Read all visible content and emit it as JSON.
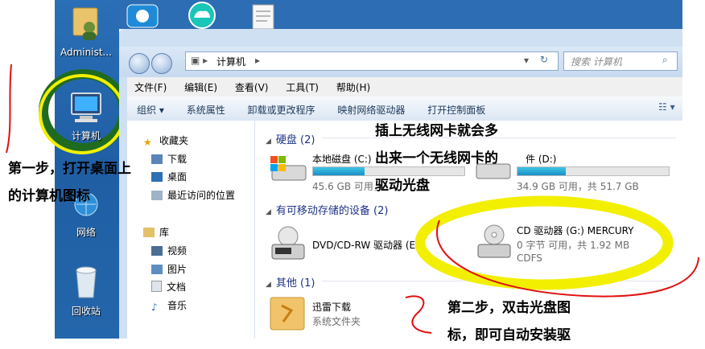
{
  "desktop": {
    "admin_label": "Administ...",
    "computer_label": "计算机",
    "network_label": "网络",
    "recycle_label": "回收站"
  },
  "window": {
    "address": "计算机",
    "search_placeholder": "搜索 计算机",
    "menu": [
      "文件(F)",
      "编辑(E)",
      "查看(V)",
      "工具(T)",
      "帮助(H)"
    ],
    "toolbar": {
      "organize": "组织",
      "items": [
        "系统属性",
        "卸载或更改程序",
        "映射网络驱动器",
        "打开控制面板"
      ]
    },
    "nav": {
      "favorites": "收藏夹",
      "downloads": "下载",
      "desktop": "桌面",
      "recent": "最近访问的位置",
      "libraries": "库",
      "videos": "视频",
      "pictures": "图片",
      "documents": "文档",
      "music": "音乐"
    },
    "groups": {
      "hdd": "硬盘 (2)",
      "removable": "有可移动存储的设备 (2)",
      "other": "其他 (1)"
    },
    "drives": {
      "c_name": "本地磁盘 (C:)",
      "c_free": "45.6 GB 可用，",
      "c_fill": 0.34,
      "d_name": "件 (D:)",
      "d_free": "34.9 GB 可用，共 51.7 GB",
      "d_fill": 0.32,
      "dvd_name": "DVD/CD-RW 驱动器 (E:)",
      "cd_name": "CD 驱动器 (G:) MERCURY",
      "cd_size": "0 字节 可用，共 1.92 MB",
      "cd_fs": "CDFS",
      "xunlei_name": "迅雷下载",
      "xunlei_type": "系统文件夹"
    }
  },
  "annotations": {
    "step1_line1": "第一步，打开桌面上",
    "step1_line2": "的计算机图标",
    "note_line1": "插上无线网卡就会多",
    "note_line2": "出来一个无线网卡的",
    "note_line3": "驱动光盘",
    "step2_line1": "第二步，双击光盘图",
    "step2_line2": "标，即可自动安装驱"
  },
  "colors": {
    "highlight_yellow": "#f2ef00",
    "highlight_green": "#1f6b1f",
    "circle_red": "#e01010"
  }
}
